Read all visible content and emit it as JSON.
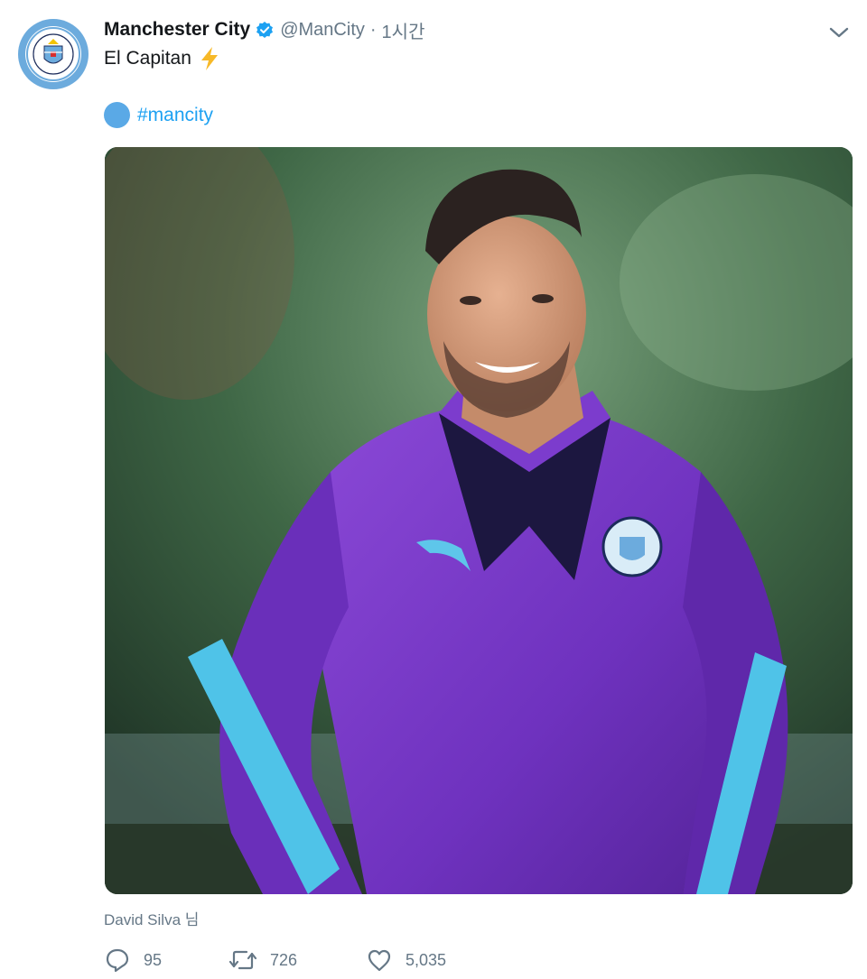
{
  "tweet": {
    "author_name": "Manchester City",
    "handle": "@ManCity",
    "separator": "·",
    "time": "1시간",
    "text": "El Capitan",
    "hashtag": "#mancity",
    "tagged_user": "David Silva 님",
    "avatar_badge_text": "MANCHESTER CITY"
  },
  "actions": {
    "replies": "95",
    "retweets": "726",
    "likes": "5,035"
  },
  "icons": {
    "verified": "verified-badge-icon",
    "emoji": "high-voltage-emoji",
    "hashtag_emoji": "blue-circle-emoji",
    "menu": "chevron-down-icon",
    "reply": "reply-icon",
    "retweet": "retweet-icon",
    "like": "heart-icon"
  },
  "colors": {
    "accent": "#1da1f2",
    "muted": "#657786",
    "city_blue": "#6cabdd",
    "kit_purple": "#7a3bc8"
  }
}
